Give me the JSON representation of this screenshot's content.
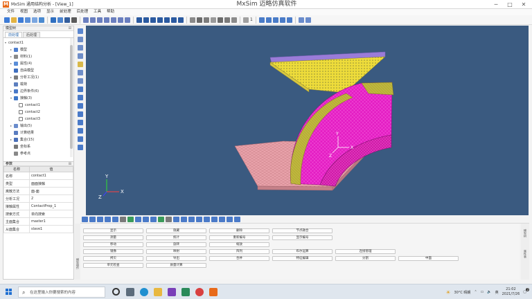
{
  "window": {
    "app_title": "MxSim 通用结构分析 - [View_1]",
    "center_title": "MxSim 迈略仿真软件",
    "controls": [
      "─",
      "□",
      "✕"
    ]
  },
  "menubar": [
    "文件",
    "视图",
    "选项",
    "显示",
    "前处理",
    "后处理",
    "工具",
    "帮助"
  ],
  "toolbar": {
    "count_label": "1"
  },
  "model_tree": {
    "header": "模型树",
    "pin": "⊞",
    "tabs": [
      "前处理",
      "后处理"
    ],
    "items": [
      {
        "label": "contact1",
        "level": 0,
        "expanded": true
      },
      {
        "label": "模型",
        "level": 1,
        "expanded": false
      },
      {
        "label": "材料(1)",
        "level": 1,
        "expanded": false
      },
      {
        "label": "属性(4)",
        "level": 1,
        "expanded": false
      },
      {
        "label": "自由模型",
        "level": 1,
        "expanded": false
      },
      {
        "label": "分析工况(1)",
        "level": 1,
        "expanded": false
      },
      {
        "label": "载荷",
        "level": 1,
        "expanded": false
      },
      {
        "label": "边界条件(6)",
        "level": 1,
        "expanded": false
      },
      {
        "label": "接触(3)",
        "level": 1,
        "expanded": true
      },
      {
        "label": "contact1",
        "level": 2,
        "expanded": false
      },
      {
        "label": "contact2",
        "level": 2,
        "expanded": false
      },
      {
        "label": "contact3",
        "level": 2,
        "expanded": false
      },
      {
        "label": "输出(5)",
        "level": 1,
        "expanded": false
      },
      {
        "label": "计算结果",
        "level": 1,
        "expanded": false
      },
      {
        "label": "集合(15)",
        "level": 1,
        "expanded": false
      },
      {
        "label": "坐标系",
        "level": 1,
        "expanded": false
      },
      {
        "label": "参考点",
        "level": 1,
        "expanded": false
      }
    ]
  },
  "properties": {
    "header": "参数",
    "pin": "⊞",
    "columns": [
      "名称",
      "值"
    ],
    "rows": [
      [
        "名称",
        "contact1"
      ],
      [
        "类型",
        "面面接触"
      ],
      [
        "离散方法",
        "面-面"
      ],
      [
        "分析工况",
        "2"
      ],
      [
        "接触属性",
        "ContactProp_1"
      ],
      [
        "搜索方式",
        "单向搜索"
      ],
      [
        "主面集合",
        "master1"
      ],
      [
        "从面集合",
        "slave1"
      ]
    ]
  },
  "viewport": {
    "background": "#3a5a80",
    "triad": {
      "x": "X",
      "y": "Y",
      "z": "Z"
    },
    "local_triad": {
      "y": "Y",
      "z": "Z",
      "x": "X"
    }
  },
  "commands": {
    "side_label": "模型操作",
    "right_labels": [
      "模型树",
      "属性表"
    ],
    "rows": [
      [
        "显示",
        "隐藏",
        "删除",
        "节点融合"
      ],
      [
        "测量",
        "统计",
        "重新编号",
        "显示编号"
      ],
      [
        "移动",
        "旋转",
        "缩放"
      ],
      [
        "镜像",
        "映射",
        "阵列",
        "布尔运算",
        "连接管理"
      ],
      [
        "拷贝",
        "导出",
        "合并",
        "特征编辑",
        "分割",
        "中面"
      ],
      [
        "单元检查",
        "质量计算"
      ]
    ]
  },
  "taskbar": {
    "search_placeholder": "在这里输入你要搜索的内容",
    "weather": "30°C 晴朗",
    "time": "21:02",
    "date": "2021/7/26",
    "ime": "英",
    "notify_count": "2"
  },
  "colors": {
    "mesh_yellow": "#f0e030",
    "mesh_magenta": "#e020c0",
    "mesh_pink": "#e8a0a8",
    "mesh_olive": "#a8a030",
    "accent_blue": "#1e5fa8"
  }
}
